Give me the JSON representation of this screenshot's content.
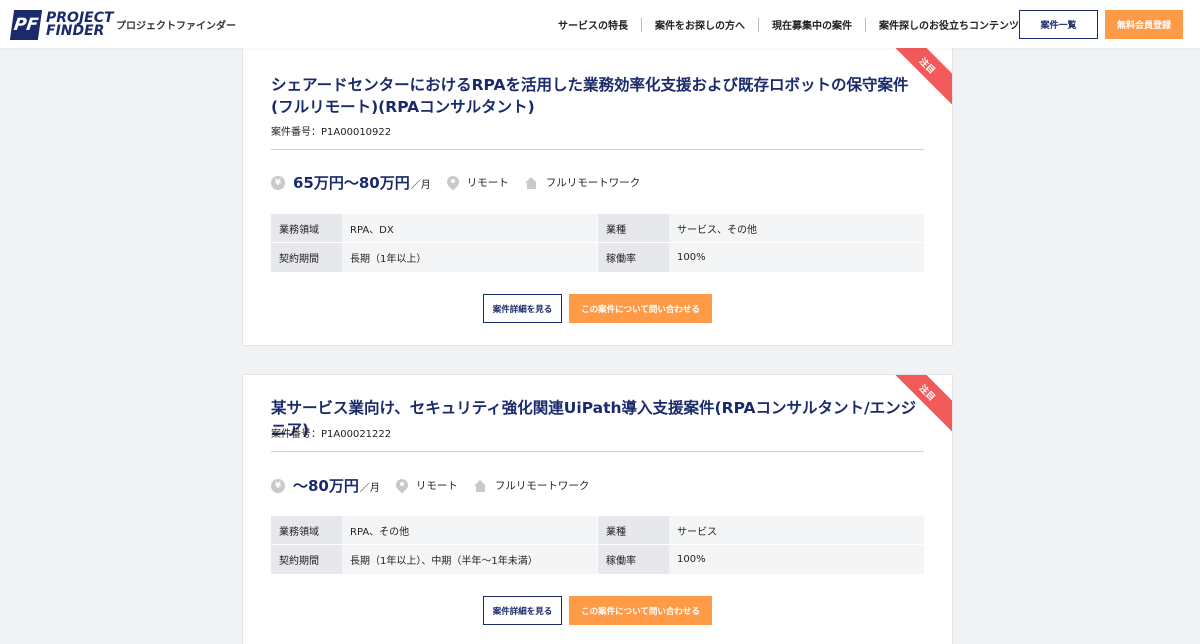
{
  "header": {
    "logo_mark": "PF",
    "logo_line1": "PROJECT",
    "logo_line2": "FINDER",
    "brand_sub": "プロジェクトファインダー",
    "nav": [
      {
        "label": "サービスの特長"
      },
      {
        "label": "案件をお探しの方へ"
      },
      {
        "label": "現在募集中の案件"
      },
      {
        "label": "案件探しのお役立ちコンテンツ"
      }
    ],
    "list_button": "案件一覧",
    "register_button": "無料会員登録"
  },
  "projects": [
    {
      "badge": "注目",
      "title": "シェアードセンターにおけるRPAを活用した業務効率化支援および既存ロボットの保守案件(フルリモート)(RPAコンサルタント)",
      "project_no": "案件番号：P1A00010922",
      "price_main": "65万円〜80万円",
      "price_unit": "／月",
      "location": "リモート",
      "work_style": "フルリモートワーク",
      "specs": {
        "field_label": "業務領域",
        "field_value": "RPA、DX",
        "industry_label": "業種",
        "industry_value": "サービス、その他",
        "period_label": "契約期間",
        "period_value": "長期（1年以上）",
        "rate_label": "稼働率",
        "rate_value": "100%"
      },
      "detail_button": "案件詳細を見る",
      "inquire_button": "この案件について問い合わせる"
    },
    {
      "badge": "注目",
      "title": "某サービス業向け、セキュリティ強化関連UiPath導入支援案件(RPAコンサルタント/エンジニア)",
      "project_no": "案件番号：P1A00021222",
      "price_main": "〜80万円",
      "price_unit": "／月",
      "location": "リモート",
      "work_style": "フルリモートワーク",
      "specs": {
        "field_label": "業務領域",
        "field_value": "RPA、その他",
        "industry_label": "業種",
        "industry_value": "サービス",
        "period_label": "契約期間",
        "period_value": "長期（1年以上）、中期（半年〜1年未満）",
        "rate_label": "稼働率",
        "rate_value": "100%"
      },
      "detail_button": "案件詳細を見る",
      "inquire_button": "この案件について問い合わせる"
    }
  ],
  "icons": {
    "yen": "yen-icon",
    "location": "pin-icon",
    "work_style": "home-icon"
  },
  "colors": {
    "navy": "#1b2a6b",
    "orange": "#ff9a47",
    "badge_red": "#f25a5a"
  }
}
